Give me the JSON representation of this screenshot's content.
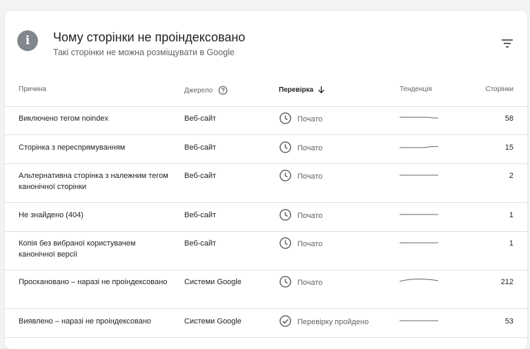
{
  "header": {
    "title": "Чому сторінки не проіндексовано",
    "subtitle": "Такі сторінки не можна розміщувати в Google"
  },
  "columns": {
    "reason": "Причина",
    "source": "Джерело",
    "validation": "Перевірка",
    "trend": "Тенденція",
    "pages": "Сторінки"
  },
  "rows": [
    {
      "reason": "Виключено тегом noindex",
      "source": "Веб-сайт",
      "status": "Почато",
      "status_type": "started",
      "pages": "58",
      "trend": "flat-dip"
    },
    {
      "reason": "Сторінка з переспрямуванням",
      "source": "Веб-сайт",
      "status": "Почато",
      "status_type": "started",
      "pages": "15",
      "trend": "flat-rise"
    },
    {
      "reason": "Альтернативна сторінка з належним тегом канонічної сторінки",
      "source": "Веб-сайт",
      "status": "Почато",
      "status_type": "started",
      "pages": "2",
      "trend": "flat"
    },
    {
      "reason": "Не знайдено (404)",
      "source": "Веб-сайт",
      "status": "Почато",
      "status_type": "started",
      "pages": "1",
      "trend": "flat"
    },
    {
      "reason": "Копія без вибраної користувачем канонічної версії",
      "source": "Веб-сайт",
      "status": "Почато",
      "status_type": "started",
      "pages": "1",
      "trend": "flat"
    },
    {
      "reason": "Проскановано – наразі не проіндексовано",
      "source": "Системи Google",
      "status": "Почато",
      "status_type": "started",
      "pages": "212",
      "trend": "arc"
    },
    {
      "reason": "Виявлено – наразі не проіндексовано",
      "source": "Системи Google",
      "status": "Перевірку пройдено",
      "status_type": "passed",
      "pages": "53",
      "trend": "flat"
    }
  ],
  "colors": {
    "icon_gray": "#80868b",
    "text_primary": "#202124",
    "text_secondary": "#5f6368",
    "divider": "#e0e0e0"
  }
}
